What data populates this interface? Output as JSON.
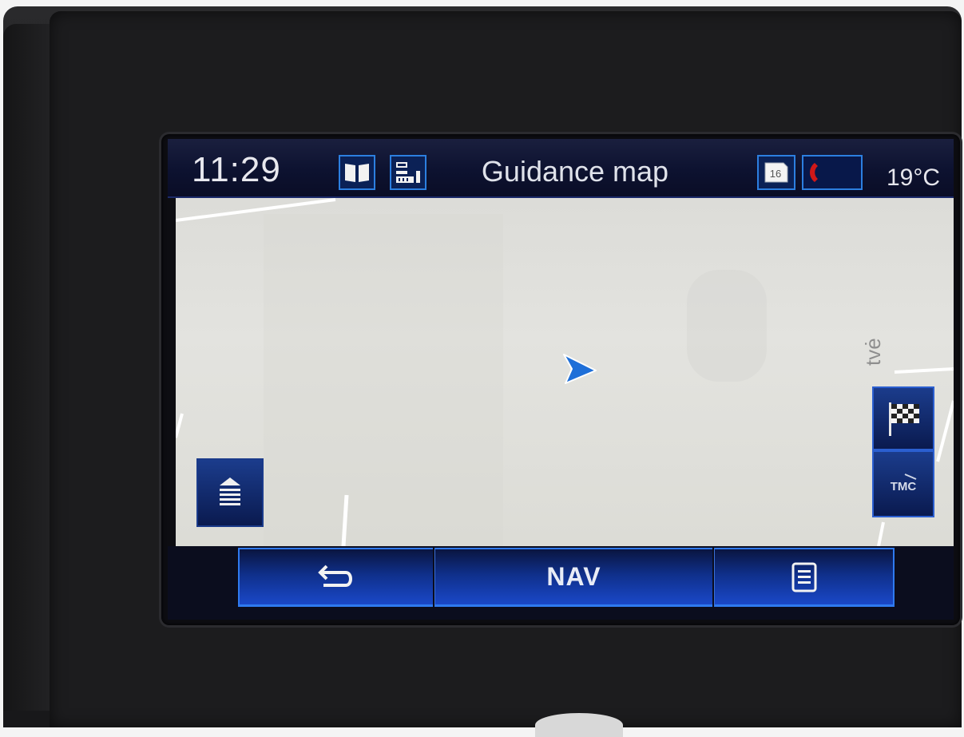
{
  "header": {
    "time": "11:29",
    "title": "Guidance map",
    "temperature": "19°C",
    "sd_card_label": "16"
  },
  "map": {
    "street_label": "tvė"
  },
  "bottom_bar": {
    "nav_label": "NAV"
  },
  "buttons": {
    "tmc_label": "TMC"
  },
  "colors": {
    "accent": "#2f7af0",
    "header_bg": "#0d1230",
    "map_bg": "#e0e0dc",
    "position_arrow": "#1e6fd8"
  },
  "icons": [
    "book-map-icon",
    "route-list-icon",
    "sd-card-icon",
    "phone-icon",
    "layers-icon",
    "checkered-flag-icon",
    "tmc-icon",
    "back-arrow-icon",
    "menu-list-icon",
    "position-arrow-icon"
  ]
}
